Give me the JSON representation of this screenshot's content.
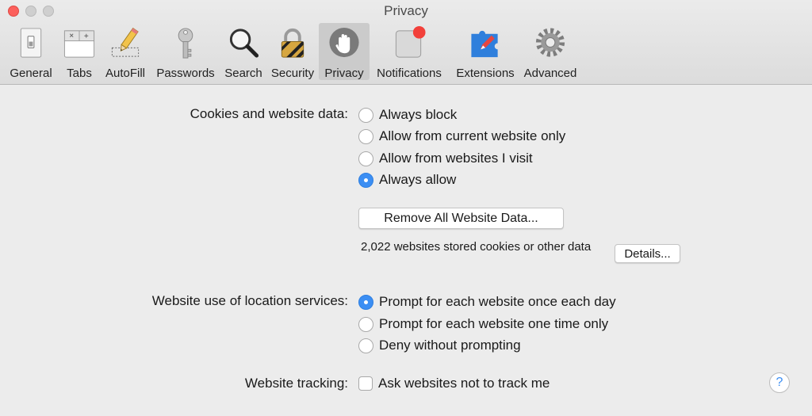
{
  "window": {
    "title": "Privacy"
  },
  "toolbar": {
    "items": [
      {
        "label": "General",
        "icon": "general-switch-icon"
      },
      {
        "label": "Tabs",
        "icon": "tabs-icon"
      },
      {
        "label": "AutoFill",
        "icon": "autofill-pencil-icon"
      },
      {
        "label": "Passwords",
        "icon": "key-icon"
      },
      {
        "label": "Search",
        "icon": "magnifier-icon"
      },
      {
        "label": "Security",
        "icon": "padlock-icon"
      },
      {
        "label": "Privacy",
        "icon": "hand-icon",
        "selected": true
      },
      {
        "label": "Notifications",
        "icon": "notification-badge-icon"
      },
      {
        "label": "Extensions",
        "icon": "puzzle-compass-icon"
      },
      {
        "label": "Advanced",
        "icon": "gear-icon"
      }
    ]
  },
  "cookies": {
    "label": "Cookies and website data:",
    "options": [
      {
        "label": "Always block",
        "selected": false
      },
      {
        "label": "Allow from current website only",
        "selected": false
      },
      {
        "label": "Allow from websites I visit",
        "selected": false
      },
      {
        "label": "Always allow",
        "selected": true
      }
    ],
    "remove_button": "Remove All Website Data...",
    "stored_text": "2,022 websites stored cookies or other data",
    "details_button": "Details..."
  },
  "location": {
    "label": "Website use of location services:",
    "options": [
      {
        "label": "Prompt for each website once each day",
        "selected": true
      },
      {
        "label": "Prompt for each website one time only",
        "selected": false
      },
      {
        "label": "Deny without prompting",
        "selected": false
      }
    ]
  },
  "tracking": {
    "label": "Website tracking:",
    "checkbox_label": "Ask websites not to track me",
    "checked": false
  },
  "help": {
    "label": "?"
  },
  "colors": {
    "accent": "#3b8ef3",
    "close": "#fc605c",
    "selected_tab_bg": "#cbcbcb"
  }
}
